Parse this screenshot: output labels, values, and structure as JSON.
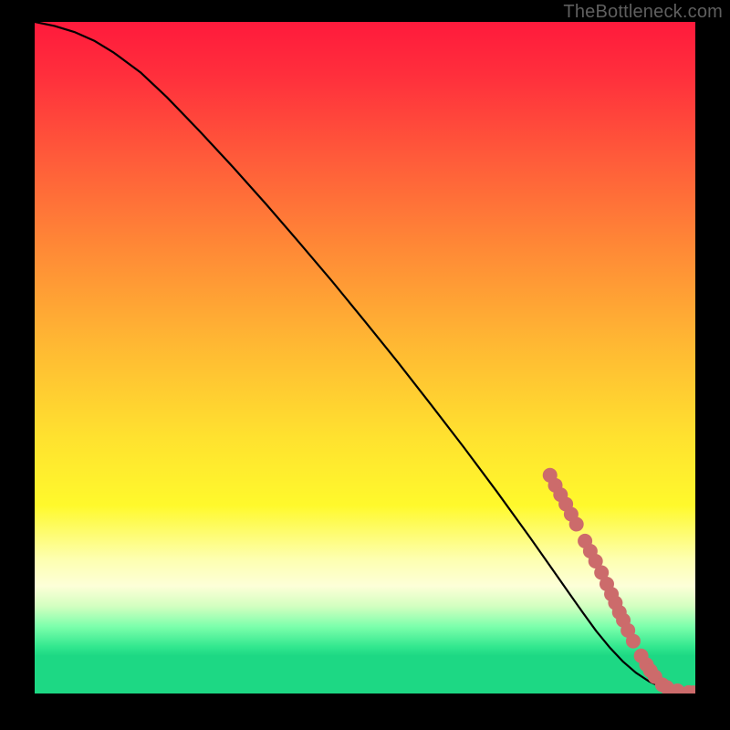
{
  "watermark": "TheBottleneck.com",
  "colors": {
    "background": "#000000",
    "curve": "#000000",
    "point": "#cc6b6b",
    "gradient_top": "#ff1a3c",
    "gradient_bottom": "#1dd884"
  },
  "chart_data": {
    "type": "line",
    "title": "",
    "xlabel": "",
    "ylabel": "",
    "xlim": [
      0,
      100
    ],
    "ylim": [
      0,
      100
    ],
    "grid": false,
    "x": [
      0,
      3,
      6,
      9,
      12,
      16,
      20,
      25,
      30,
      35,
      40,
      45,
      50,
      55,
      60,
      65,
      70,
      75,
      78,
      81,
      83,
      85,
      87,
      89,
      91,
      93,
      95,
      98,
      100
    ],
    "y": [
      100,
      99.4,
      98.5,
      97.2,
      95.4,
      92.5,
      88.8,
      83.7,
      78.4,
      72.9,
      67.2,
      61.4,
      55.4,
      49.3,
      43.0,
      36.6,
      30.0,
      23.2,
      19.0,
      14.8,
      12.0,
      9.3,
      6.9,
      4.8,
      3.1,
      1.8,
      0.9,
      0.2,
      0.0
    ],
    "points": [
      {
        "x": 78.0,
        "y": 32.5
      },
      {
        "x": 78.8,
        "y": 31.0
      },
      {
        "x": 79.6,
        "y": 29.6
      },
      {
        "x": 80.4,
        "y": 28.2
      },
      {
        "x": 81.2,
        "y": 26.7
      },
      {
        "x": 82.0,
        "y": 25.2
      },
      {
        "x": 83.3,
        "y": 22.7
      },
      {
        "x": 84.1,
        "y": 21.2
      },
      {
        "x": 84.9,
        "y": 19.7
      },
      {
        "x": 85.8,
        "y": 18.0
      },
      {
        "x": 86.6,
        "y": 16.3
      },
      {
        "x": 87.3,
        "y": 14.8
      },
      {
        "x": 87.9,
        "y": 13.5
      },
      {
        "x": 88.5,
        "y": 12.1
      },
      {
        "x": 89.1,
        "y": 10.9
      },
      {
        "x": 89.8,
        "y": 9.4
      },
      {
        "x": 90.6,
        "y": 7.8
      },
      {
        "x": 91.8,
        "y": 5.6
      },
      {
        "x": 92.6,
        "y": 4.3
      },
      {
        "x": 93.2,
        "y": 3.4
      },
      {
        "x": 93.9,
        "y": 2.5
      },
      {
        "x": 95.0,
        "y": 1.3
      },
      {
        "x": 95.7,
        "y": 0.9
      },
      {
        "x": 97.3,
        "y": 0.4
      },
      {
        "x": 99.0,
        "y": 0.15
      },
      {
        "x": 99.7,
        "y": 0.12
      }
    ],
    "point_radius_px": 8
  }
}
